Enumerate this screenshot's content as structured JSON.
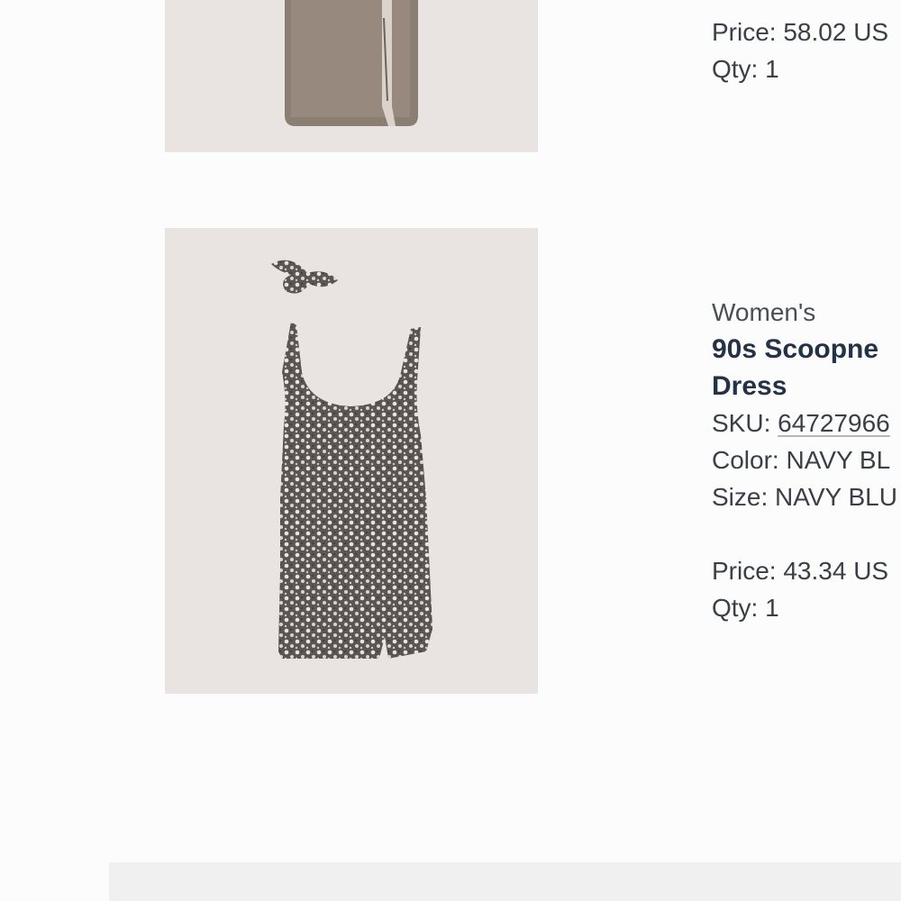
{
  "items": [
    {
      "image_alt": "taupe knit midi skirt with slit",
      "price_label": "Price:",
      "price_value": "58.02 US",
      "qty_label": "Qty:",
      "qty_value": "1"
    },
    {
      "image_alt": "floral print scoopneck mini dress with matching scrunchie",
      "category": "Women's",
      "name_line1": "90s Scoopne",
      "name_line2": "Dress",
      "sku_label": "SKU:",
      "sku_value": "64727966",
      "color_label": "Color:",
      "color_value": "NAVY BL",
      "size_label": "Size:",
      "size_value": "NAVY BLU",
      "price_label": "Price:",
      "price_value": "43.34 US",
      "qty_label": "Qty:",
      "qty_value": "1"
    }
  ],
  "colors": {
    "background": "#fdfcfc",
    "image_background": "#e9e4e2",
    "product_name": "#233247",
    "text": "#3b4046",
    "footer_bar": "#f0f0f1"
  }
}
